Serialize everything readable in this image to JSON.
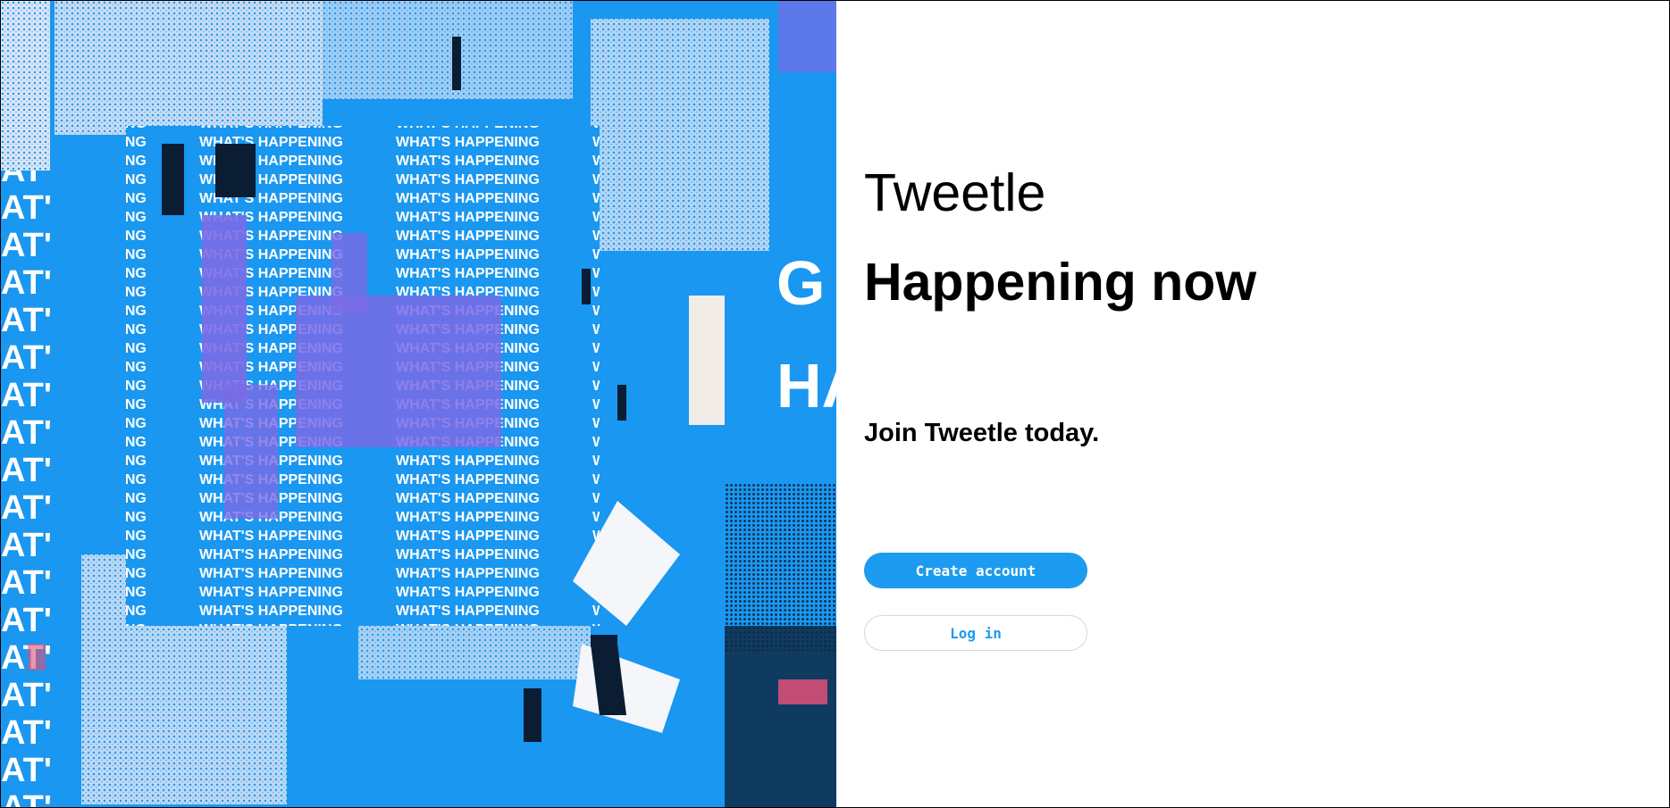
{
  "app": {
    "brand_name": "Tweetle"
  },
  "main": {
    "headline": "Happening now",
    "subheadline": "Join Tweetle today.",
    "create_account_label": "Create account",
    "login_label": "Log in"
  },
  "hero": {
    "image_text": "WHAT'S HAPPENING",
    "icon": "collage-image"
  },
  "colors": {
    "accent": "#1d9bf0",
    "hero_blue": "#1a97f0",
    "hero_purple": "#7a6be6",
    "hero_light": "#dfe6f3",
    "border": "#cfd9de",
    "text": "#000000"
  }
}
